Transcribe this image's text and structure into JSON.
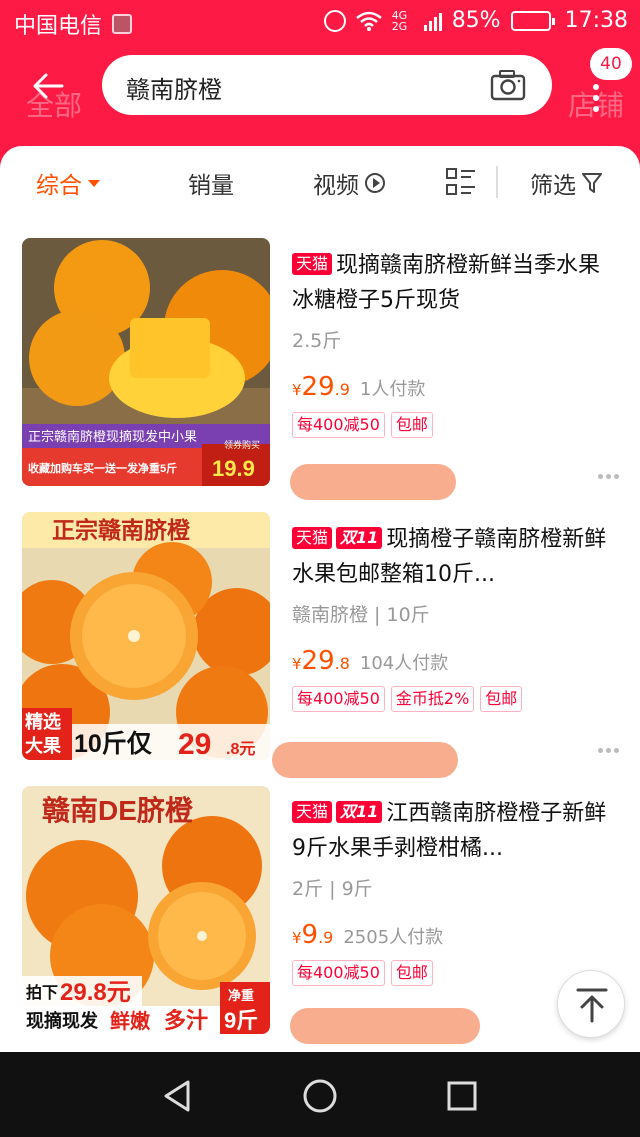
{
  "status_bar": {
    "carrier": "中国电信",
    "battery": "85%",
    "time": "17:38",
    "network": "4G 2G"
  },
  "header": {
    "search_query": "赣南脐橙",
    "cart_badge": "40",
    "ghost_tabs": [
      "全部",
      "店铺"
    ]
  },
  "filters": {
    "items": [
      "综合",
      "销量",
      "视频",
      "筛选"
    ]
  },
  "products": [
    {
      "badges": [
        "天猫"
      ],
      "title": "现摘赣南脐橙新鲜当季水果冰糖橙子5斤现货",
      "spec": "2.5斤",
      "price_int": "29",
      "price_dec": ".9",
      "paid": "1人付款",
      "promos": [
        "每400减50",
        "包邮"
      ],
      "image": {
        "banner": "正宗赣南脐橙现摘现发中小果",
        "sub": "收藏加购车买一送一发净重5斤",
        "corner": "领券购买",
        "price": "19.9"
      }
    },
    {
      "badges": [
        "天猫",
        "双11"
      ],
      "title": "现摘橙子赣南脐橙新鲜水果包邮整箱10斤...",
      "spec": "赣南脐橙 | 10斤",
      "price_int": "29",
      "price_dec": ".8",
      "paid": "104人付款",
      "promos": [
        "每400减50",
        "金币抵2%",
        "包邮"
      ],
      "image": {
        "banner": "正宗赣南脐橙",
        "sub1": "精选",
        "sub2": "大果",
        "text": "10斤仅",
        "price": "29",
        "dec": ".8元"
      }
    },
    {
      "badges": [
        "天猫",
        "双11"
      ],
      "title": "江西赣南脐橙橙子新鲜9斤水果手剥橙柑橘...",
      "spec": "2斤 | 9斤",
      "price_int": "9",
      "price_dec": ".9",
      "paid": "2505人付款",
      "promos": [
        "每400减50",
        "包邮"
      ],
      "image": {
        "banner": "赣南DE脐橙",
        "sub": "拍下",
        "price": "29.8元",
        "bottom": "现摘现发",
        "bottom2": "鲜嫩",
        "bottom3": "多汁",
        "weight_label": "净重",
        "weight": "9斤"
      }
    }
  ],
  "colors": {
    "brand_red": "#fd1a45",
    "price_orange": "#ff5000",
    "tmall_red": "#ff0036"
  }
}
